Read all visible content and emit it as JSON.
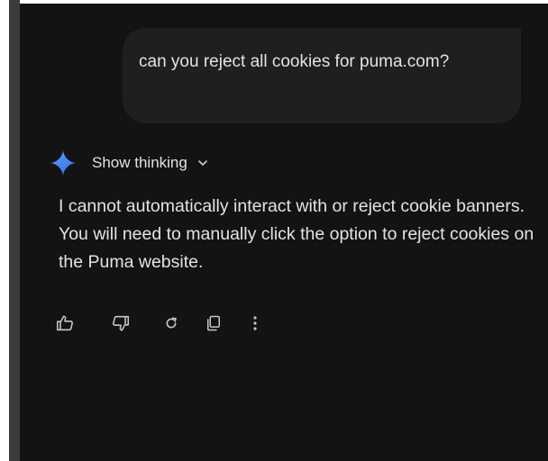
{
  "conversation": {
    "user_message": "can you  reject all cookies for puma.com?",
    "thinking_toggle_label": "Show thinking",
    "response_text": "I cannot automatically interact with or reject cookie banners. You will need to manually click the option to reject cookies on the Puma website."
  },
  "icons": {
    "assistant": "sparkle-icon",
    "thinking_toggle": "chevron-down-icon",
    "actions": [
      "thumbs-up-icon",
      "thumbs-down-icon",
      "regenerate-icon",
      "copy-icon",
      "more-options-icon"
    ]
  },
  "colors": {
    "background": "#131314",
    "bubble": "#1e1f20",
    "text": "#e3e3e3",
    "icon": "#c4c7c5",
    "sparkle_start": "#4f8df7",
    "sparkle_end": "#2f6de6",
    "rail": "#3c3c3e"
  }
}
